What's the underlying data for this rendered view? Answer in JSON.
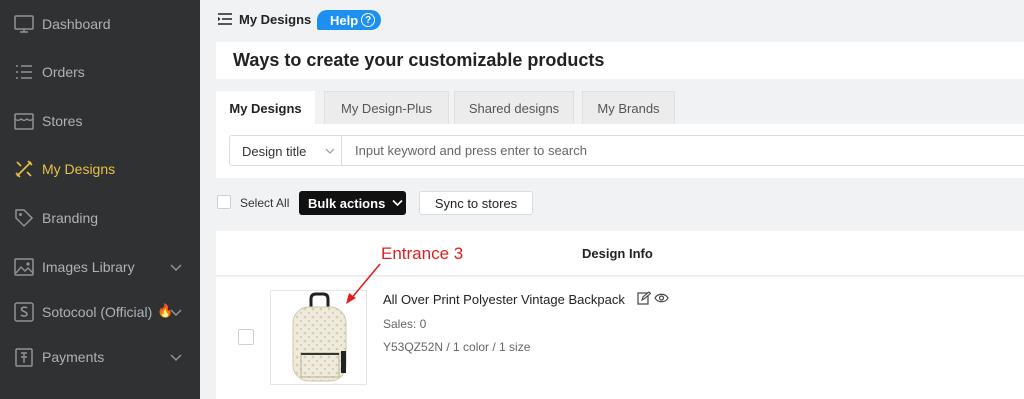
{
  "sidebar": {
    "items": [
      {
        "label": "Dashboard",
        "icon": "monitor-icon"
      },
      {
        "label": "Orders",
        "icon": "list-icon"
      },
      {
        "label": "Stores",
        "icon": "store-icon"
      },
      {
        "label": "My Designs",
        "icon": "design-tools-icon",
        "active": true
      },
      {
        "label": "Branding",
        "icon": "tag-icon"
      },
      {
        "label": "Images Library",
        "icon": "image-icon",
        "expandable": true
      },
      {
        "label": "Sotocool (Official)",
        "icon": "s-logo-icon",
        "expandable": true,
        "badge_icon": "fire-icon"
      },
      {
        "label": "Payments",
        "icon": "wallet-icon",
        "expandable": true
      }
    ],
    "colors": {
      "background": "#2f3132",
      "text": "#aeb3b6",
      "active": "#e8c04a"
    }
  },
  "header": {
    "crumb": "My Designs",
    "help_label": "Help"
  },
  "page": {
    "title": "Ways to create your customizable products"
  },
  "tabs": [
    {
      "label": "My Designs",
      "active": true
    },
    {
      "label": "My Design-Plus"
    },
    {
      "label": "Shared designs"
    },
    {
      "label": "My Brands"
    }
  ],
  "filter": {
    "field_selected": "Design title",
    "search_placeholder": "Input keyword and press enter to search"
  },
  "toolbar": {
    "select_all_label": "Select All",
    "bulk_label": "Bulk actions",
    "sync_label": "Sync to stores"
  },
  "table": {
    "columns": [
      "Design Info"
    ],
    "rows": [
      {
        "title": "All Over Print Polyester Vintage Backpack",
        "sales": "Sales: 0",
        "sku": "Y53QZ52N / 1 color / 1 size"
      }
    ]
  },
  "annotation": {
    "text": "Entrance 3",
    "color": "#e02020"
  }
}
